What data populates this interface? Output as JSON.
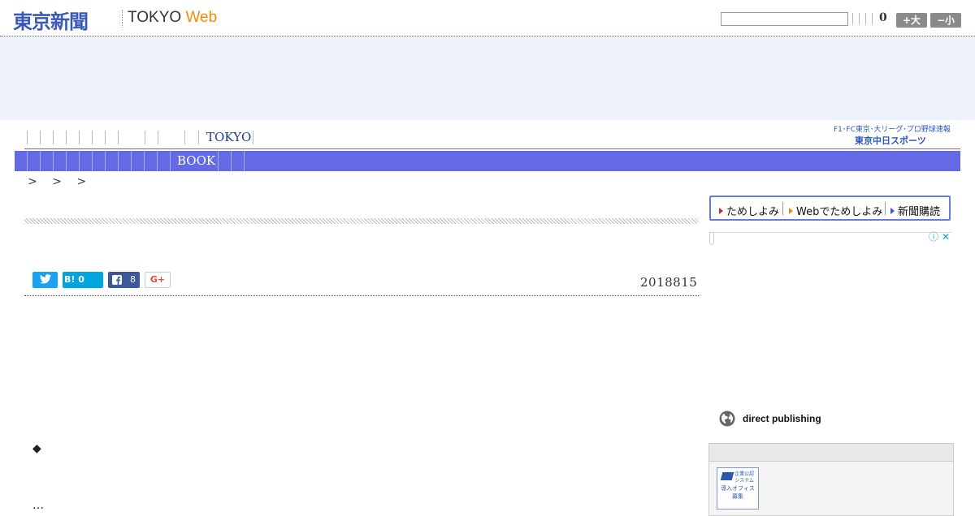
{
  "header": {
    "logo_jp": "東京新聞",
    "logo_en_1": "TOKYO ",
    "logo_en_2": "Web",
    "search_placeholder": "",
    "count": "0",
    "font_bigger": "+大",
    "font_smaller": "−小"
  },
  "nav": {
    "tokyo_label": "TOKYO",
    "chunichi_line1": "F1･FC東京･大リーグ･プロ野球速報",
    "chunichi_line2": "東京中日スポーツ"
  },
  "blue_bar": {
    "book_label": "BOOK"
  },
  "breadcrumb": {
    "text": "> > >"
  },
  "social": {
    "hatena_label": "B!",
    "hatena_count": "0",
    "facebook_count": "8",
    "gplus_label": "G+"
  },
  "article": {
    "date": "2018815",
    "diamond": "◆",
    "ellipsis": "…"
  },
  "subscribe": {
    "link1": "ためしよみ",
    "link2": "Webでためしよみ",
    "link3": "新聞購読"
  },
  "ad": {
    "info": "ⓘ",
    "close": "✕"
  },
  "sidebar": {
    "direct_publishing": "direct publishing",
    "thumb_line1": "企業公認",
    "thumb_line2": "システム",
    "thumb_line3": "導入オフィス",
    "thumb_line4": "募集"
  },
  "colors": {
    "accent_blue": "#6469e4",
    "logo_blue": "#3a58b8",
    "web_orange": "#f08c00",
    "ad_band": "#edf1fb"
  }
}
